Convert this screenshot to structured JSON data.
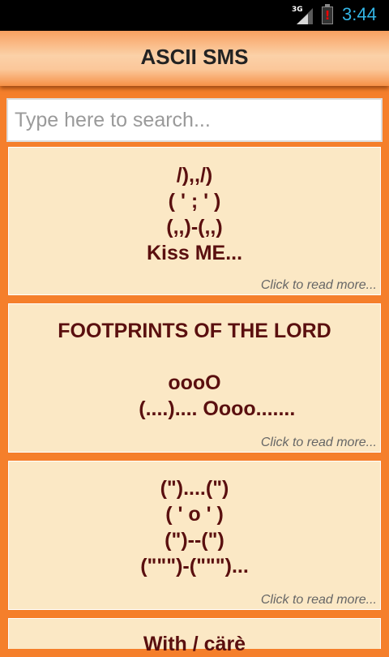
{
  "status_bar": {
    "network": "3G",
    "time": "3:44",
    "battery_alert": "!"
  },
  "app": {
    "title": "ASCII SMS"
  },
  "search": {
    "placeholder": "Type here to search..."
  },
  "list": {
    "more_label": "Click to read more...",
    "items": [
      {
        "text": "/),,/)\n( ' ; ' )\n(,,)-(,,)\nKiss ME..."
      },
      {
        "text": "FOOTPRINTS OF THE LORD\n\noooO\n        (....).... Oooo......."
      },
      {
        "text": "(\")....(\")\n( ' o ' )\n(\")--(\")\n(\"\"\")-(\"\"\")..."
      },
      {
        "text": "With / cärè"
      }
    ]
  }
}
